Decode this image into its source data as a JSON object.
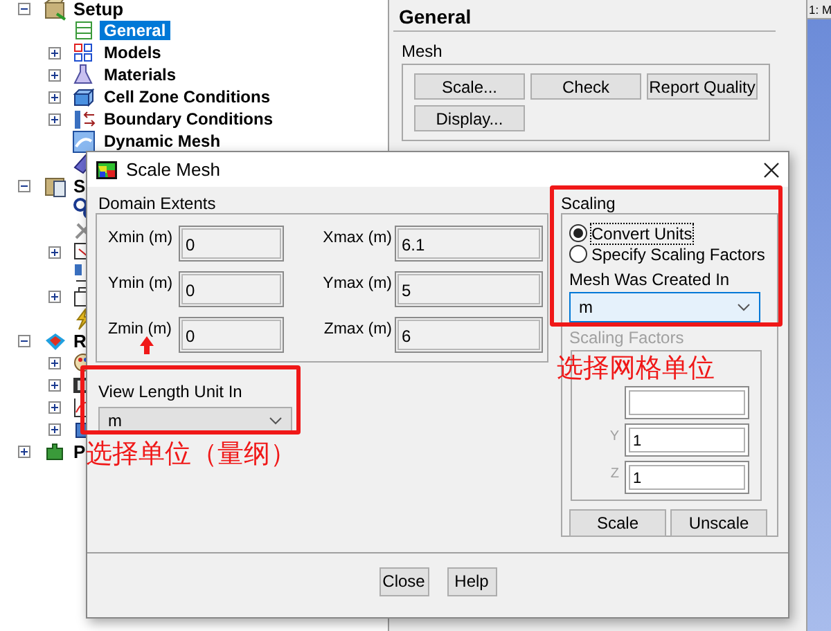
{
  "tree": [
    {
      "label": "Setup",
      "expanded": true,
      "selected": false,
      "children": [
        {
          "label": "General",
          "selected": true,
          "expandable": false
        },
        {
          "label": "Models",
          "selected": false,
          "expandable": true
        },
        {
          "label": "Materials",
          "selected": false,
          "expandable": true
        },
        {
          "label": "Cell Zone Conditions",
          "selected": false,
          "expandable": true
        },
        {
          "label": "Boundary Conditions",
          "selected": false,
          "expandable": true
        },
        {
          "label": "Dynamic Mesh",
          "selected": false,
          "expandable": false
        },
        {
          "selected": false,
          "expandable": false
        }
      ]
    },
    {
      "label": "S",
      "expanded": true,
      "selected": false,
      "children": [
        {
          "selected": false,
          "expandable": false
        },
        {
          "selected": false,
          "expandable": false
        },
        {
          "selected": false,
          "expandable": true
        },
        {
          "selected": false,
          "expandable": false
        },
        {
          "selected": false,
          "expandable": true
        },
        {
          "selected": false,
          "expandable": false
        }
      ]
    },
    {
      "label": "R",
      "expanded": true,
      "selected": false,
      "children": [
        {
          "selected": false,
          "expandable": true
        },
        {
          "selected": false,
          "expandable": true
        },
        {
          "selected": false,
          "expandable": true
        },
        {
          "selected": false,
          "expandable": true
        }
      ]
    },
    {
      "label": "P",
      "expanded": false,
      "selected": false
    }
  ],
  "general_panel": {
    "title": "General",
    "mesh": {
      "label": "Mesh",
      "buttons": [
        "Scale...",
        "Check",
        "Report Quality",
        "Display..."
      ]
    }
  },
  "graphics_tab": {
    "label": "1: M"
  },
  "dialog": {
    "title": "Scale Mesh",
    "domain_extents": {
      "label": "Domain Extents",
      "fields": [
        {
          "label": "Xmin (m)",
          "value": "0"
        },
        {
          "label": "Xmax (m)",
          "value": "6.1"
        },
        {
          "label": "Ymin (m)",
          "value": "0"
        },
        {
          "label": "Ymax (m)",
          "value": "5"
        },
        {
          "label": "Zmin (m)",
          "value": "0"
        },
        {
          "label": "Zmax (m)",
          "value": "6"
        }
      ]
    },
    "view_length_unit": {
      "label": "View Length Unit In",
      "value": "m"
    },
    "scaling": {
      "label": "Scaling",
      "options": [
        {
          "label": "Convert Units",
          "selected": true
        },
        {
          "label": "Specify Scaling Factors",
          "selected": false
        }
      ],
      "mesh_created_in": {
        "label": "Mesh Was Created In",
        "value": "m"
      },
      "scaling_factors": {
        "label": "Scaling Factors",
        "disabled": true,
        "fields": [
          {
            "kind": "covered"
          },
          {
            "kind": "entry",
            "label": "Y",
            "value": "1"
          },
          {
            "kind": "entry",
            "label": "Z",
            "value": "1"
          }
        ]
      },
      "buttons": [
        "Scale",
        "Unscale"
      ]
    },
    "buttons": [
      "Close",
      "Help"
    ]
  },
  "annotations": [
    {
      "kind": "box"
    },
    {
      "kind": "box"
    },
    {
      "kind": "arrow"
    },
    {
      "kind": "note",
      "text": "选择网格单位"
    },
    {
      "kind": "note",
      "text": "选择单位（量纲）"
    }
  ]
}
